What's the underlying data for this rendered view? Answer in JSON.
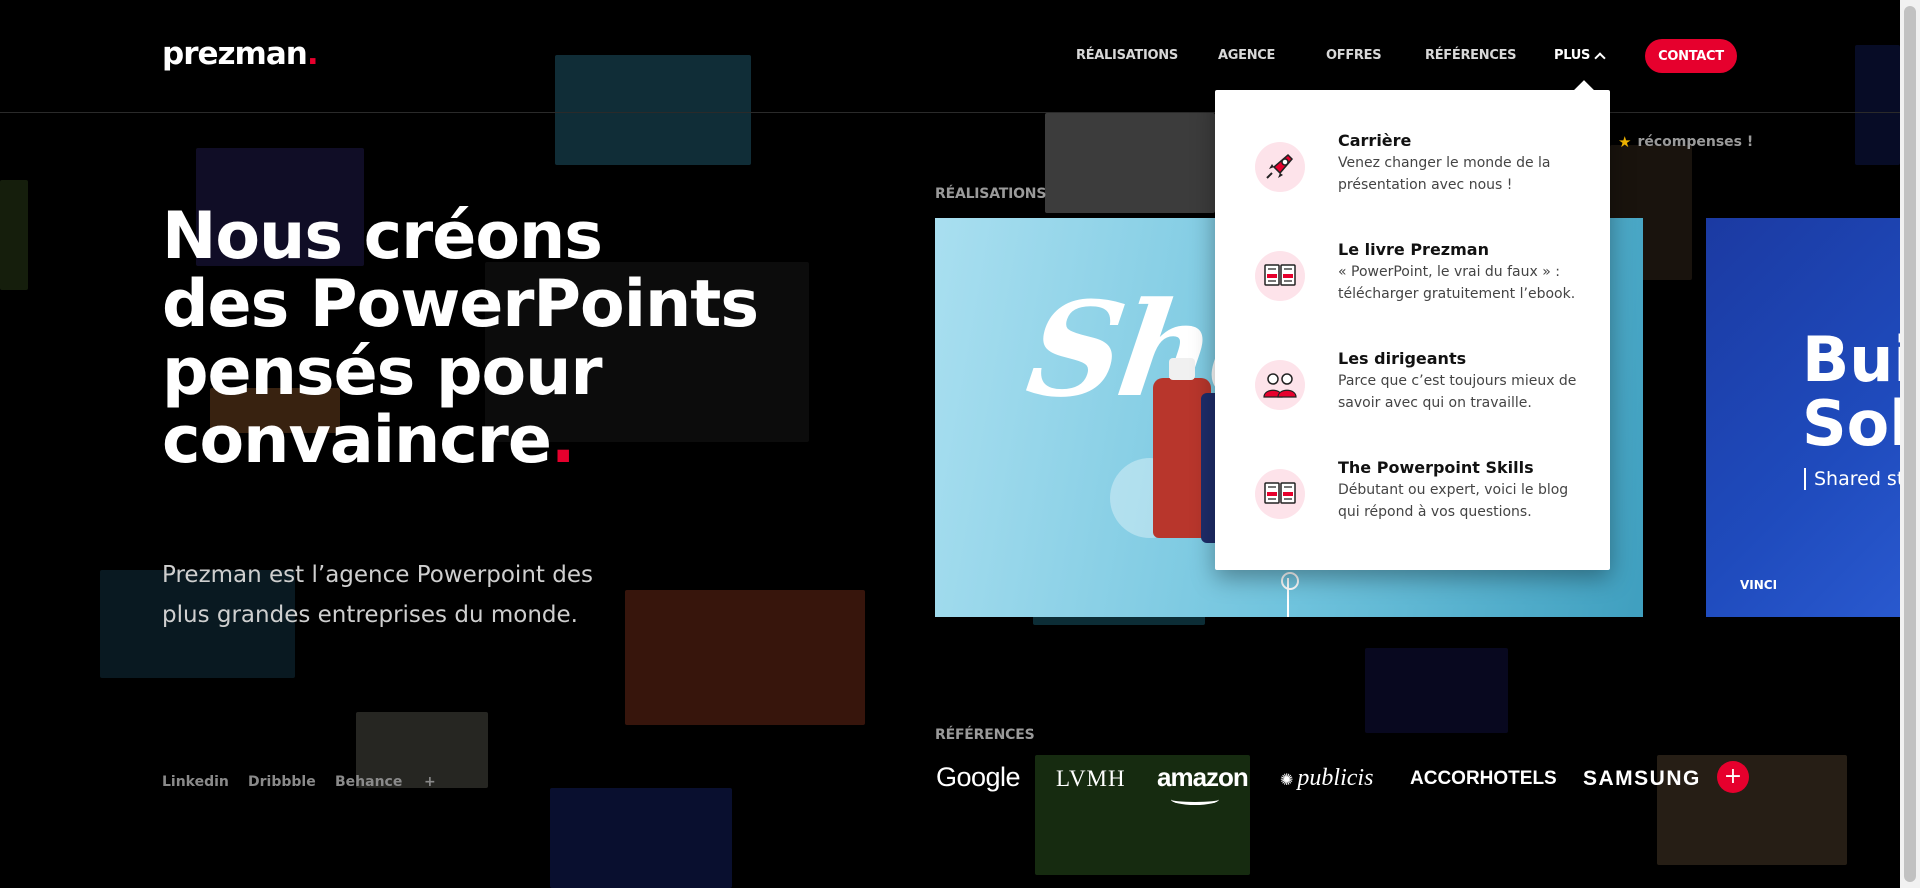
{
  "header": {
    "logo": "prezman",
    "logo_dot": ".",
    "nav": {
      "realisations": "RÉALISATIONS",
      "agence": "AGENCE",
      "offres": "OFFRES",
      "references": "RÉFÉRENCES",
      "plus": "PLUS"
    },
    "contact": "CONTACT"
  },
  "hero": {
    "lines": [
      "Nous créons",
      "des PowerPoints",
      "pensés pour",
      "convaincre"
    ],
    "dot": ".",
    "lead": "Prezman est l’agence Powerpoint des plus grandes entreprises du monde."
  },
  "social": [
    "Linkedin",
    "Dribbble",
    "Behance",
    "+"
  ],
  "realisations": {
    "label": "RÉALISATIONS",
    "awards": "récompenses !",
    "card1_script": "Sho",
    "card2_title_1": "Bui",
    "card2_title_2": "Sol",
    "card2_sub": "Shared st",
    "card2_brand": "VINCI"
  },
  "references": {
    "label": "RÉFÉRENCES",
    "brands": [
      "Google",
      "LVMH",
      "amazon",
      "publicis",
      "ACCORHOTELS",
      "SAMSUNG"
    ],
    "more": "+"
  },
  "dropdown": {
    "items": [
      {
        "title": "Carrière",
        "desc_1": "Venez changer le monde de la",
        "desc_2": "présentation avec nous !",
        "icon": "rocket-icon"
      },
      {
        "title": "Le livre Prezman",
        "desc_1": "« PowerPoint, le vrai du faux » :",
        "desc_2": "télécharger gratuitement l’ebook.",
        "icon": "book-icon"
      },
      {
        "title": "Les dirigeants",
        "desc_1": "Parce que c’est toujours mieux de",
        "desc_2": "savoir avec qui on travaille.",
        "icon": "team-icon"
      },
      {
        "title": "The Powerpoint Skills",
        "desc_1": "Débutant ou expert, voici le blog",
        "desc_2": "qui répond à vos questions.",
        "icon": "book-icon"
      }
    ]
  },
  "colors": {
    "accent": "#e6002d",
    "background": "#000000"
  }
}
